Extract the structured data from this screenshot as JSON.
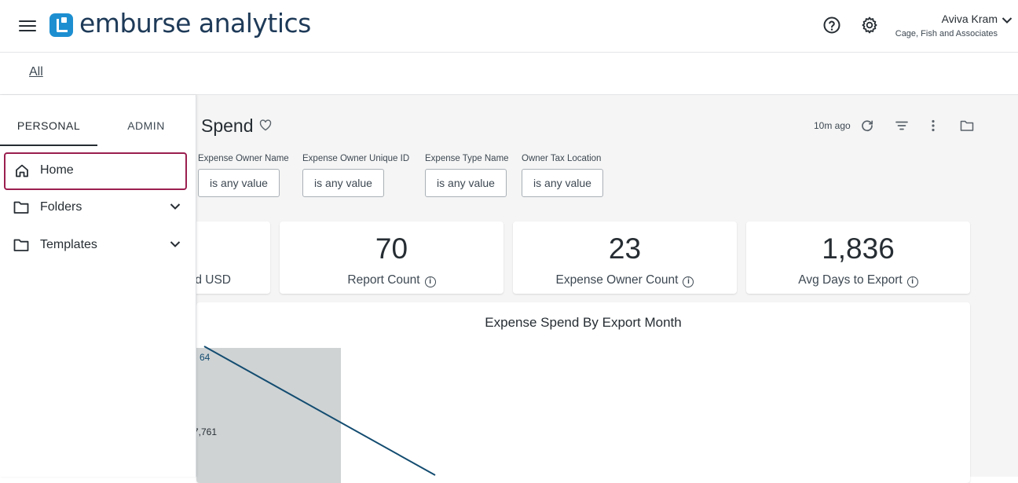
{
  "header": {
    "logo_text": "emburse analytics",
    "user_name": "Aviva Kram",
    "user_org": "Cage, Fish and Associates",
    "icons": [
      "menu-icon",
      "help-icon",
      "gear-icon",
      "chevron-down-icon"
    ]
  },
  "breadcrumb": {
    "all": "All"
  },
  "sidebar": {
    "tabs": [
      "PERSONAL",
      "ADMIN"
    ],
    "items": [
      {
        "label": "Home",
        "icon": "home-icon"
      },
      {
        "label": "Folders",
        "icon": "folder-icon"
      },
      {
        "label": "Templates",
        "icon": "folder-icon"
      }
    ]
  },
  "dashboard": {
    "title_visible": "Spend",
    "updated": "10m ago",
    "filters": [
      {
        "label": "Expense Owner Name",
        "value": "is any value"
      },
      {
        "label": "Expense Owner Unique ID",
        "value": "is any value"
      },
      {
        "label": "Expense Type Name",
        "value": "is any value"
      },
      {
        "label": "Owner Tax Location",
        "value": "is any value"
      }
    ],
    "kpis": [
      {
        "value": "",
        "label": "d USD"
      },
      {
        "value": "70",
        "label": "Report Count"
      },
      {
        "value": "23",
        "label": "Expense Owner Count"
      },
      {
        "value": "1,836",
        "label": "Avg Days to Export"
      }
    ],
    "chart": {
      "title": "Expense Spend By Export Month",
      "line_label": "64",
      "bar_label": "7,761",
      "colors": {
        "bar": "#cfd3d4",
        "line": "#134c70"
      }
    }
  }
}
